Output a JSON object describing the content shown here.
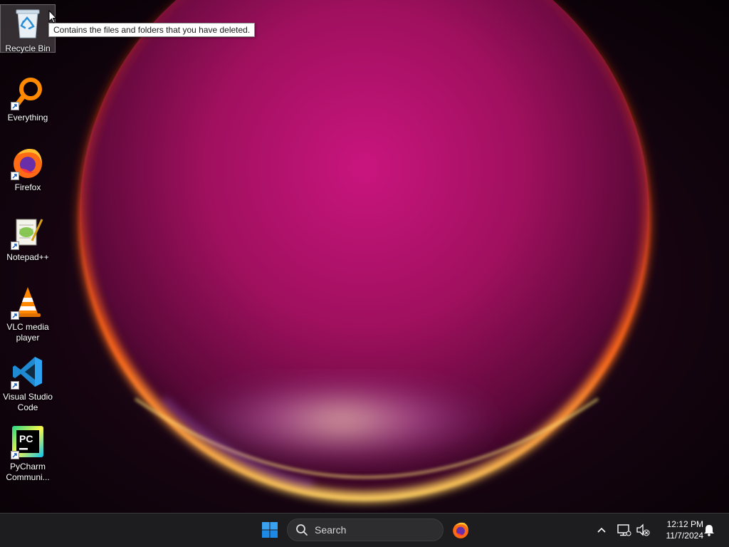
{
  "desktop": {
    "icons": [
      {
        "label": "Recycle Bin",
        "icon": "recycle-bin-icon"
      },
      {
        "label": "Everything",
        "icon": "everything-search-icon"
      },
      {
        "label": "Firefox",
        "icon": "firefox-icon"
      },
      {
        "label": "Notepad++",
        "icon": "notepad-plus-plus-icon"
      },
      {
        "label": "VLC media player",
        "icon": "vlc-icon"
      },
      {
        "label": "Visual Studio Code",
        "icon": "vscode-icon"
      },
      {
        "label": "PyCharm Communi...",
        "icon": "pycharm-icon"
      }
    ],
    "tooltip": "Contains the files and folders that you have deleted."
  },
  "taskbar": {
    "start_icon": "windows-logo-icon",
    "search_placeholder": "Search",
    "pinned_app_icon": "firefox-icon",
    "clock_time": "12:12 PM",
    "clock_date": "11/7/2024"
  },
  "colors": {
    "taskbar_bg": "#1d1c1f",
    "windows_accent": "#1e90ff",
    "wallpaper_magenta": "#c5187a",
    "wallpaper_orange": "#ff6a1a"
  }
}
